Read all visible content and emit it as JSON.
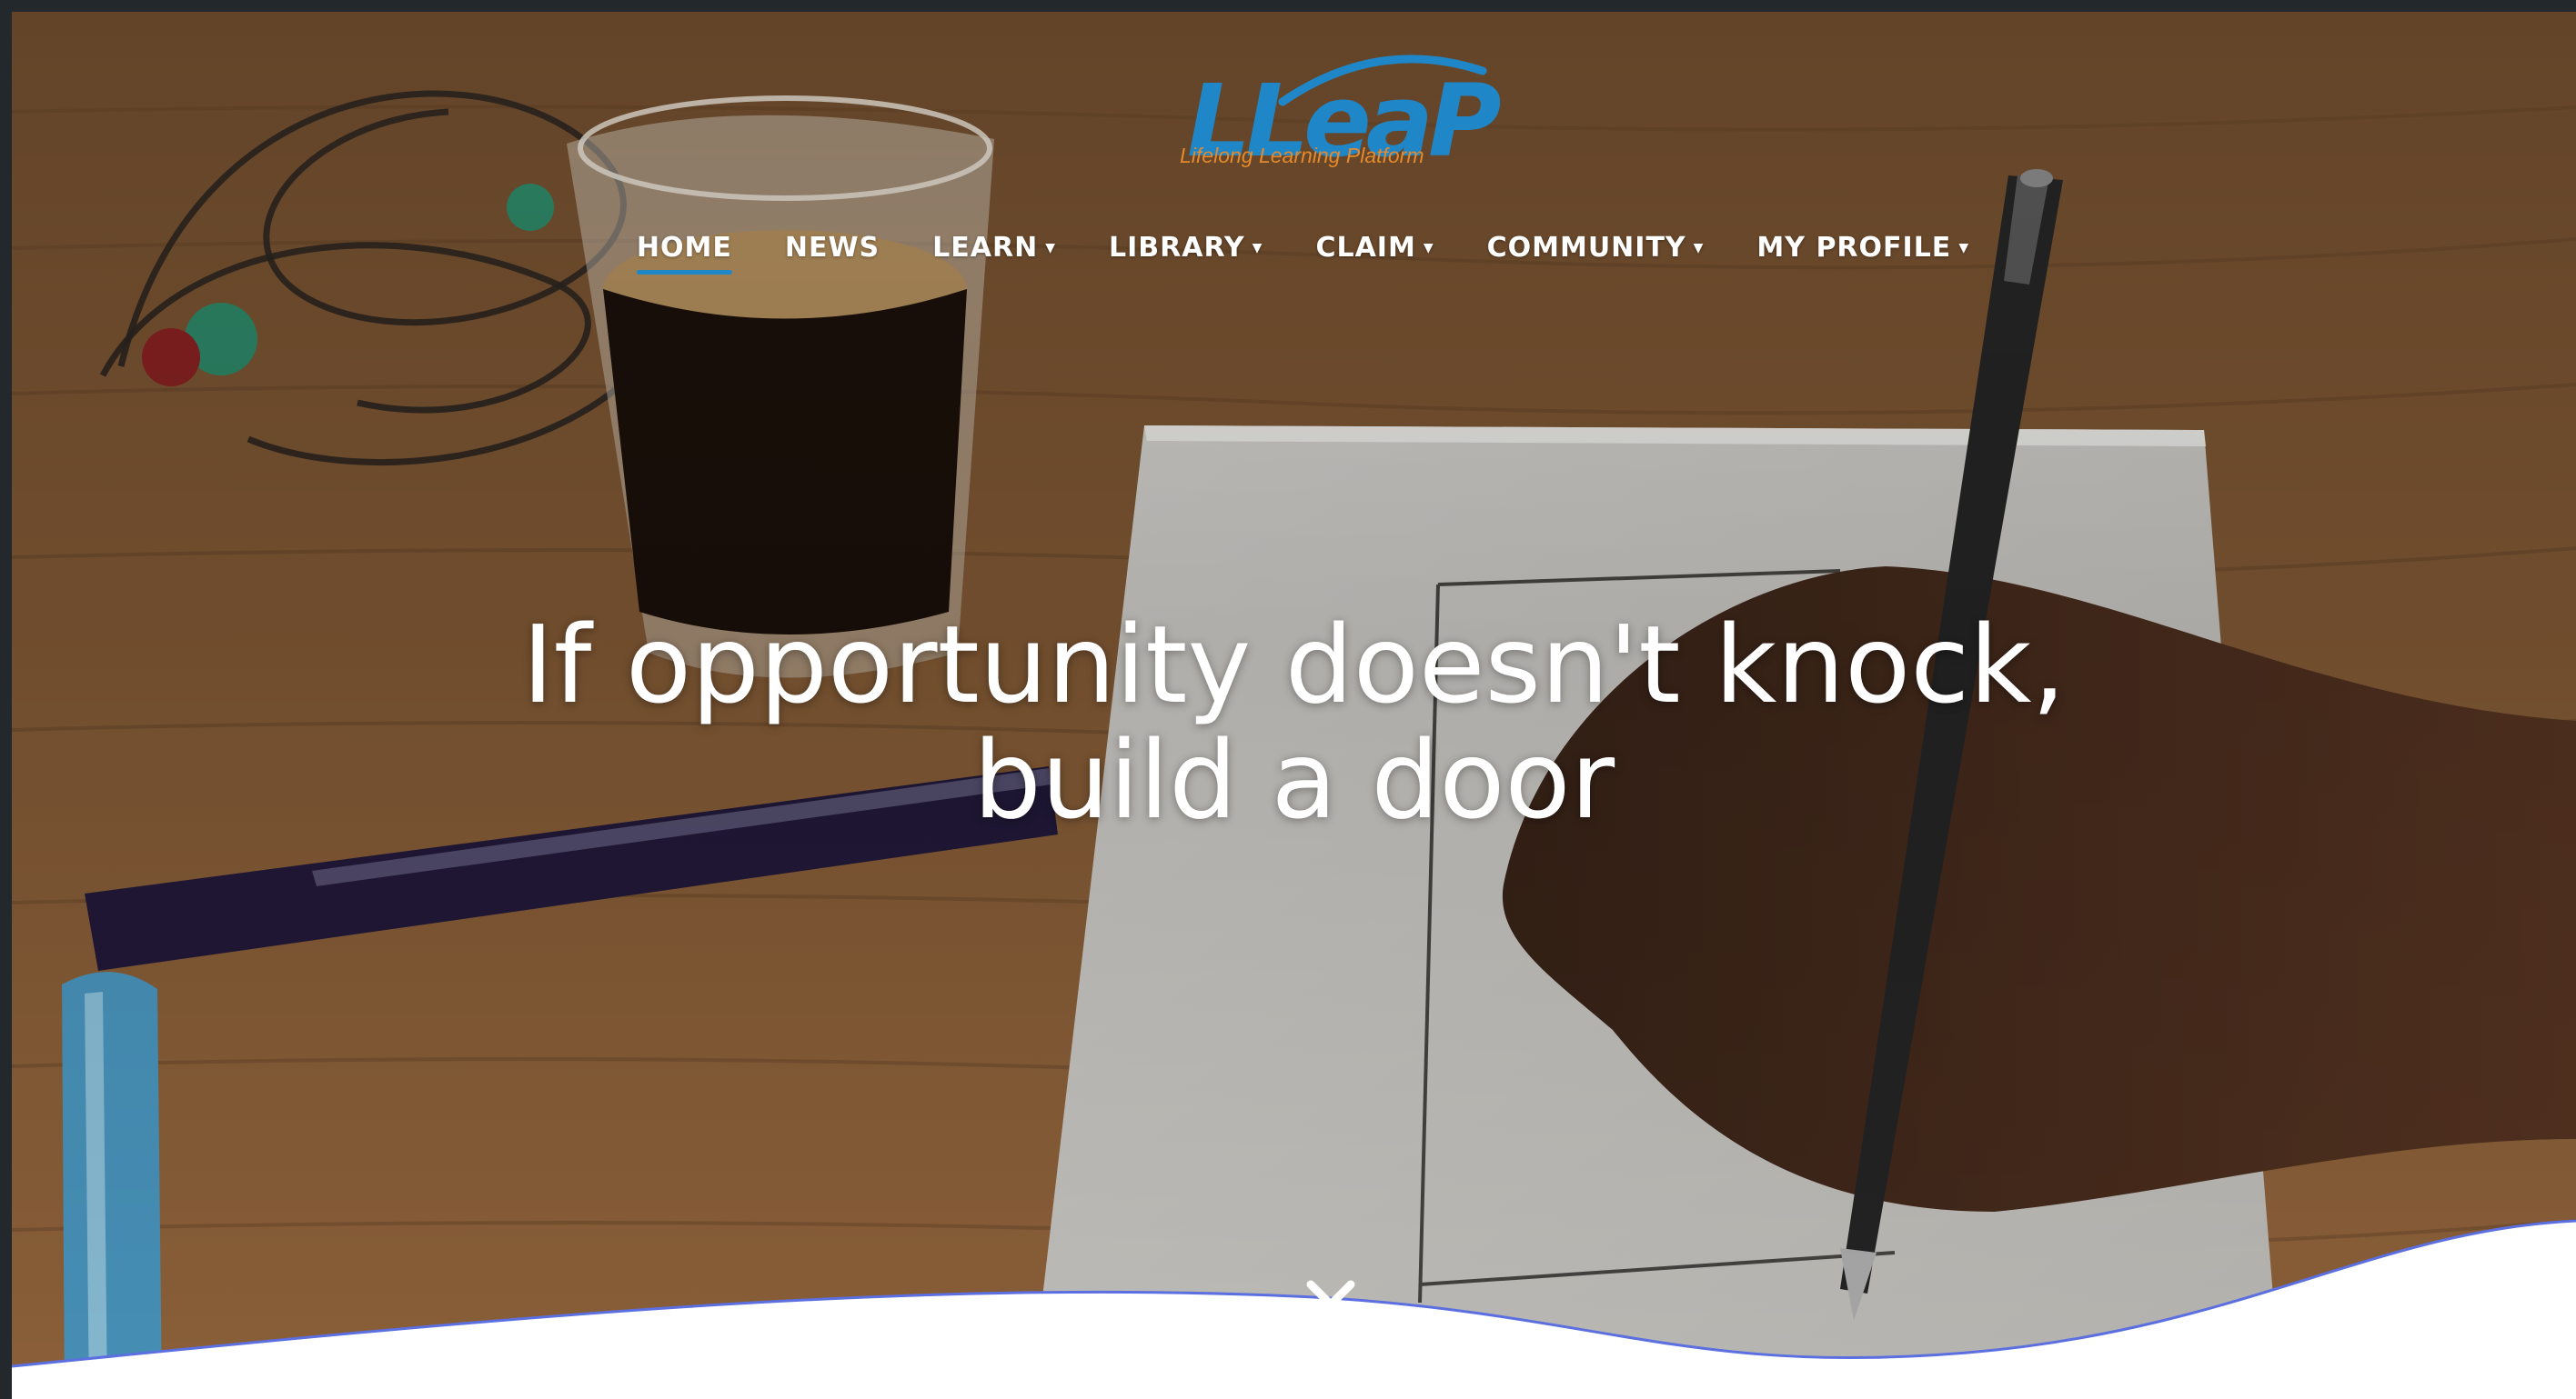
{
  "logo": {
    "wordmark": "LLeaP",
    "tagline": "Lifelong Learning Platform"
  },
  "nav": {
    "items": [
      {
        "label": "HOME",
        "active": true,
        "has_dropdown": false
      },
      {
        "label": "NEWS",
        "active": false,
        "has_dropdown": false
      },
      {
        "label": "LEARN",
        "active": false,
        "has_dropdown": true
      },
      {
        "label": "LIBRARY",
        "active": false,
        "has_dropdown": true
      },
      {
        "label": "CLAIM",
        "active": false,
        "has_dropdown": true
      },
      {
        "label": "COMMUNITY",
        "active": false,
        "has_dropdown": true
      },
      {
        "label": "MY PROFILE",
        "active": false,
        "has_dropdown": true
      }
    ]
  },
  "hero": {
    "headline_line1": "If opportunity doesn't knock,",
    "headline_line2": "build a door",
    "scroll_icon": "chevron-down-icon"
  },
  "colors": {
    "brand_blue": "#1f87c8",
    "brand_orange": "#e48a2c",
    "wave_stroke": "#5b6fe0",
    "frame": "#22282c"
  }
}
